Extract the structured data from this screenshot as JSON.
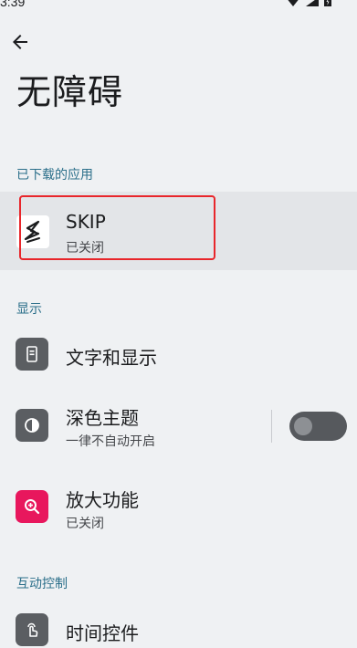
{
  "status_bar": {
    "time": "3:39",
    "wifi_icon": "wifi-icon",
    "signal_icon": "signal-icon",
    "battery_icon": "battery-icon"
  },
  "header": {
    "back_icon": "arrow-left-icon",
    "title": "无障碍"
  },
  "sections": {
    "downloaded_apps": {
      "header": "已下载的应用",
      "items": [
        {
          "title": "SKIP",
          "subtitle": "已关闭",
          "icon": "skip-app-icon"
        }
      ]
    },
    "display": {
      "header": "显示",
      "items": [
        {
          "title": "文字和显示",
          "icon": "text-display-icon",
          "icon_bg": "#5b5e62"
        },
        {
          "title": "深色主题",
          "subtitle": "一律不自动开启",
          "icon": "dark-theme-icon",
          "icon_bg": "#5b5e62",
          "toggle_on": false
        },
        {
          "title": "放大功能",
          "subtitle": "已关闭",
          "icon": "magnify-icon",
          "icon_bg": "#e8175d"
        }
      ]
    },
    "interaction": {
      "header": "互动控制",
      "items": [
        {
          "title": "时间控件",
          "icon": "touch-timing-icon",
          "icon_bg": "#5b5e62"
        }
      ]
    }
  },
  "colors": {
    "background": "#eff1f3",
    "section_header": "#2b6f8a",
    "highlight": "#e8262b",
    "skip_row_bg": "#e3e5e8"
  }
}
